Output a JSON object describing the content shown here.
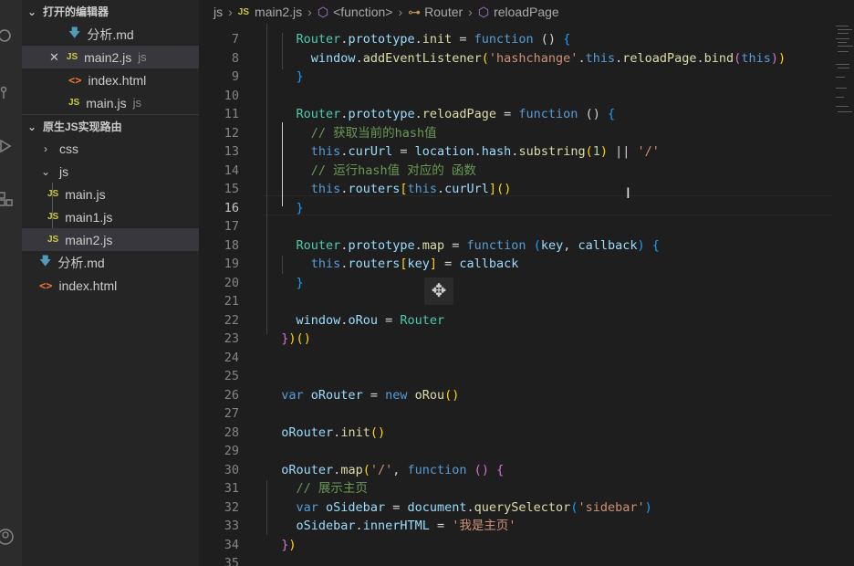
{
  "sidebar": {
    "open_editors_header": "打开的编辑器",
    "open_editors": [
      {
        "name": "分析.md",
        "suffix": ""
      },
      {
        "name": "main2.js",
        "suffix": "js"
      },
      {
        "name": "index.html",
        "suffix": ""
      },
      {
        "name": "main.js",
        "suffix": "js"
      }
    ],
    "project_header": "原生JS实现路由",
    "tree": {
      "css": "css",
      "js": "js",
      "js_files": [
        "main.js",
        "main1.js",
        "main2.js"
      ],
      "md": "分析.md",
      "html": "index.html"
    },
    "icons": {
      "js": "JS",
      "html": "<>"
    }
  },
  "breadcrumb": [
    "js",
    "main2.js",
    "<function>",
    "Router",
    "reloadPage"
  ],
  "editor": {
    "current_line": 16,
    "lines": [
      {
        "n": 7,
        "tokens": [
          [
            "ws",
            "    "
          ],
          [
            "t",
            "Router"
          ],
          [
            "w",
            "."
          ],
          [
            "v",
            "prototype"
          ],
          [
            "w",
            "."
          ],
          [
            "f",
            "init"
          ],
          [
            "w",
            " = "
          ],
          [
            "k",
            "function"
          ],
          [
            "w",
            " () "
          ],
          [
            "b3",
            "{"
          ]
        ]
      },
      {
        "n": 8,
        "tokens": [
          [
            "ws",
            "      "
          ],
          [
            "v",
            "window"
          ],
          [
            "w",
            "."
          ],
          [
            "f",
            "addEventListener"
          ],
          [
            "b1",
            "("
          ],
          [
            "s",
            "'hashchange'"
          ],
          [
            "w",
            "."
          ],
          [
            "k",
            "this"
          ],
          [
            "w",
            "."
          ],
          [
            "f",
            "reloadPage"
          ],
          [
            "w",
            "."
          ],
          [
            "f",
            "bind"
          ],
          [
            "b2",
            "("
          ],
          [
            "k",
            "this"
          ],
          [
            "b2",
            ")"
          ],
          [
            "b1",
            ")"
          ]
        ]
      },
      {
        "n": 9,
        "tokens": [
          [
            "ws",
            "    "
          ],
          [
            "b3",
            "}"
          ]
        ]
      },
      {
        "n": 10,
        "tokens": []
      },
      {
        "n": 11,
        "tokens": [
          [
            "ws",
            "    "
          ],
          [
            "t",
            "Router"
          ],
          [
            "w",
            "."
          ],
          [
            "v",
            "prototype"
          ],
          [
            "w",
            "."
          ],
          [
            "f",
            "reloadPage"
          ],
          [
            "w",
            " = "
          ],
          [
            "k",
            "function"
          ],
          [
            "w",
            " () "
          ],
          [
            "b3",
            "{"
          ]
        ]
      },
      {
        "n": 12,
        "tokens": [
          [
            "ws",
            "      "
          ],
          [
            "c",
            "// 获取当前的hash值"
          ]
        ]
      },
      {
        "n": 13,
        "tokens": [
          [
            "ws",
            "      "
          ],
          [
            "k",
            "this"
          ],
          [
            "w",
            "."
          ],
          [
            "v",
            "curUrl"
          ],
          [
            "w",
            " = "
          ],
          [
            "v",
            "location"
          ],
          [
            "w",
            "."
          ],
          [
            "v",
            "hash"
          ],
          [
            "w",
            "."
          ],
          [
            "f",
            "substring"
          ],
          [
            "b1",
            "("
          ],
          [
            "n",
            "1"
          ],
          [
            "b1",
            ")"
          ],
          [
            "w",
            " || "
          ],
          [
            "s",
            "'/'"
          ]
        ]
      },
      {
        "n": 14,
        "tokens": [
          [
            "ws",
            "      "
          ],
          [
            "c",
            "// 运行hash值 对应的 函数"
          ]
        ]
      },
      {
        "n": 15,
        "tokens": [
          [
            "ws",
            "      "
          ],
          [
            "k",
            "this"
          ],
          [
            "w",
            "."
          ],
          [
            "v",
            "routers"
          ],
          [
            "b1",
            "["
          ],
          [
            "k",
            "this"
          ],
          [
            "w",
            "."
          ],
          [
            "v",
            "curUrl"
          ],
          [
            "b1",
            "]"
          ],
          [
            "b1",
            "("
          ],
          [
            "b1",
            ")"
          ]
        ]
      },
      {
        "n": 16,
        "tokens": [
          [
            "ws",
            "    "
          ],
          [
            "b3",
            "}"
          ]
        ]
      },
      {
        "n": 17,
        "tokens": []
      },
      {
        "n": 18,
        "tokens": [
          [
            "ws",
            "    "
          ],
          [
            "t",
            "Router"
          ],
          [
            "w",
            "."
          ],
          [
            "v",
            "prototype"
          ],
          [
            "w",
            "."
          ],
          [
            "f",
            "map"
          ],
          [
            "w",
            " = "
          ],
          [
            "k",
            "function"
          ],
          [
            "w",
            " "
          ],
          [
            "b3",
            "("
          ],
          [
            "v",
            "key"
          ],
          [
            "w",
            ", "
          ],
          [
            "v",
            "callback"
          ],
          [
            "b3",
            ")"
          ],
          [
            "w",
            " "
          ],
          [
            "b3",
            "{"
          ]
        ]
      },
      {
        "n": 19,
        "tokens": [
          [
            "ws",
            "      "
          ],
          [
            "k",
            "this"
          ],
          [
            "w",
            "."
          ],
          [
            "v",
            "routers"
          ],
          [
            "b1",
            "["
          ],
          [
            "v",
            "key"
          ],
          [
            "b1",
            "]"
          ],
          [
            "w",
            " = "
          ],
          [
            "v",
            "callback"
          ]
        ]
      },
      {
        "n": 20,
        "tokens": [
          [
            "ws",
            "    "
          ],
          [
            "b3",
            "}"
          ]
        ]
      },
      {
        "n": 21,
        "tokens": []
      },
      {
        "n": 22,
        "tokens": [
          [
            "ws",
            "    "
          ],
          [
            "v",
            "window"
          ],
          [
            "w",
            "."
          ],
          [
            "v",
            "oRou"
          ],
          [
            "w",
            " = "
          ],
          [
            "t",
            "Router"
          ]
        ]
      },
      {
        "n": 23,
        "tokens": [
          [
            "ws",
            "  "
          ],
          [
            "b2",
            "}"
          ],
          [
            "b1",
            ")"
          ],
          [
            "b1",
            "("
          ],
          [
            "b1",
            ")"
          ]
        ]
      },
      {
        "n": 24,
        "tokens": []
      },
      {
        "n": 25,
        "tokens": []
      },
      {
        "n": 26,
        "tokens": [
          [
            "ws",
            "  "
          ],
          [
            "k",
            "var"
          ],
          [
            "w",
            " "
          ],
          [
            "v",
            "oRouter"
          ],
          [
            "w",
            " = "
          ],
          [
            "k",
            "new"
          ],
          [
            "w",
            " "
          ],
          [
            "f",
            "oRou"
          ],
          [
            "b1",
            "("
          ],
          [
            "b1",
            ")"
          ]
        ]
      },
      {
        "n": 27,
        "tokens": []
      },
      {
        "n": 28,
        "tokens": [
          [
            "ws",
            "  "
          ],
          [
            "v",
            "oRouter"
          ],
          [
            "w",
            "."
          ],
          [
            "f",
            "init"
          ],
          [
            "b1",
            "("
          ],
          [
            "b1",
            ")"
          ]
        ]
      },
      {
        "n": 29,
        "tokens": []
      },
      {
        "n": 30,
        "tokens": [
          [
            "ws",
            "  "
          ],
          [
            "v",
            "oRouter"
          ],
          [
            "w",
            "."
          ],
          [
            "f",
            "map"
          ],
          [
            "b1",
            "("
          ],
          [
            "s",
            "'/'"
          ],
          [
            "w",
            ", "
          ],
          [
            "k",
            "function"
          ],
          [
            "w",
            " "
          ],
          [
            "b2",
            "("
          ],
          [
            "b2",
            ")"
          ],
          [
            "w",
            " "
          ],
          [
            "b2",
            "{"
          ]
        ]
      },
      {
        "n": 31,
        "tokens": [
          [
            "ws",
            "    "
          ],
          [
            "c",
            "// 展示主页"
          ]
        ]
      },
      {
        "n": 32,
        "tokens": [
          [
            "ws",
            "    "
          ],
          [
            "k",
            "var"
          ],
          [
            "w",
            " "
          ],
          [
            "v",
            "oSidebar"
          ],
          [
            "w",
            " = "
          ],
          [
            "v",
            "document"
          ],
          [
            "w",
            "."
          ],
          [
            "f",
            "querySelector"
          ],
          [
            "b3",
            "("
          ],
          [
            "s",
            "'sidebar'"
          ],
          [
            "b3",
            ")"
          ]
        ]
      },
      {
        "n": 33,
        "tokens": [
          [
            "ws",
            "    "
          ],
          [
            "v",
            "oSidebar"
          ],
          [
            "w",
            "."
          ],
          [
            "v",
            "innerHTML"
          ],
          [
            "w",
            " = "
          ],
          [
            "s",
            "'我是主页'"
          ]
        ]
      },
      {
        "n": 34,
        "tokens": [
          [
            "ws",
            "  "
          ],
          [
            "b2",
            "}"
          ],
          [
            "b1",
            ")"
          ]
        ]
      },
      {
        "n": 35,
        "tokens": []
      }
    ]
  }
}
